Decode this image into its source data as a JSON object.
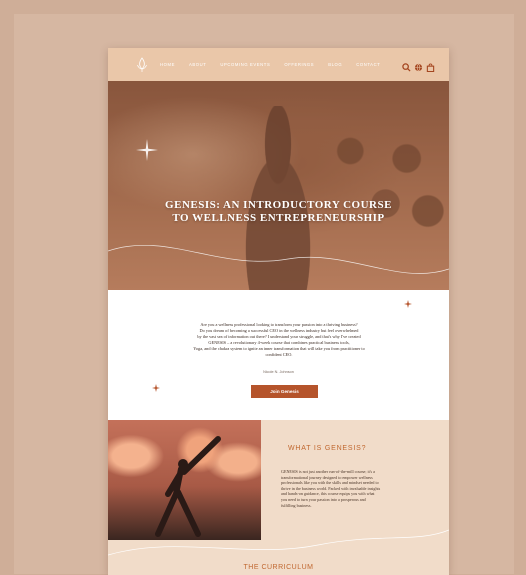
{
  "nav": {
    "links": [
      "Home",
      "About",
      "Upcoming Events",
      "Offerings",
      "Blog",
      "Contact"
    ],
    "icons": [
      "search-icon",
      "globe-icon",
      "bag-icon"
    ]
  },
  "hero": {
    "title_line1": "GENESIS: AN INTRODUCTORY COURSE",
    "title_line2": "TO WELLNESS ENTREPRENEURSHIP"
  },
  "intro": {
    "lines": [
      "Are you a wellness professional looking to transform your passion into a thriving business?",
      "Do you dream of becoming a successful CEO in the wellness industry but feel overwhelmed",
      "by the vast sea of information out there? I understand your struggle, and that's why I've created",
      "GENESIS – a revolutionary 4-week course that combines practical business tools,",
      "Yoga, and the chakra system to ignite an inner transformation that will take you from practitioner to",
      "confident CEO."
    ],
    "author": "Nicole N. Johnson",
    "button_label": "Join Genesis"
  },
  "what": {
    "title": "WHAT IS GENESIS?",
    "lines": [
      "GENESIS is not just another run-of-the-mill course; it's a",
      "transformational journey designed to empower wellness",
      "professionals like you with the skills and mindset needed to",
      "thrive in the business world. Packed with invaluable insights",
      "and hands-on guidance, this course equips you with what",
      "you need to turn your passion into a prosperous and",
      "fulfilling business."
    ]
  },
  "curriculum": {
    "title": "THE CURRICULUM"
  },
  "colors": {
    "accent": "#b5542b",
    "heading": "#c0672f",
    "nav": "#eac7a9",
    "background": "#cfae98"
  }
}
